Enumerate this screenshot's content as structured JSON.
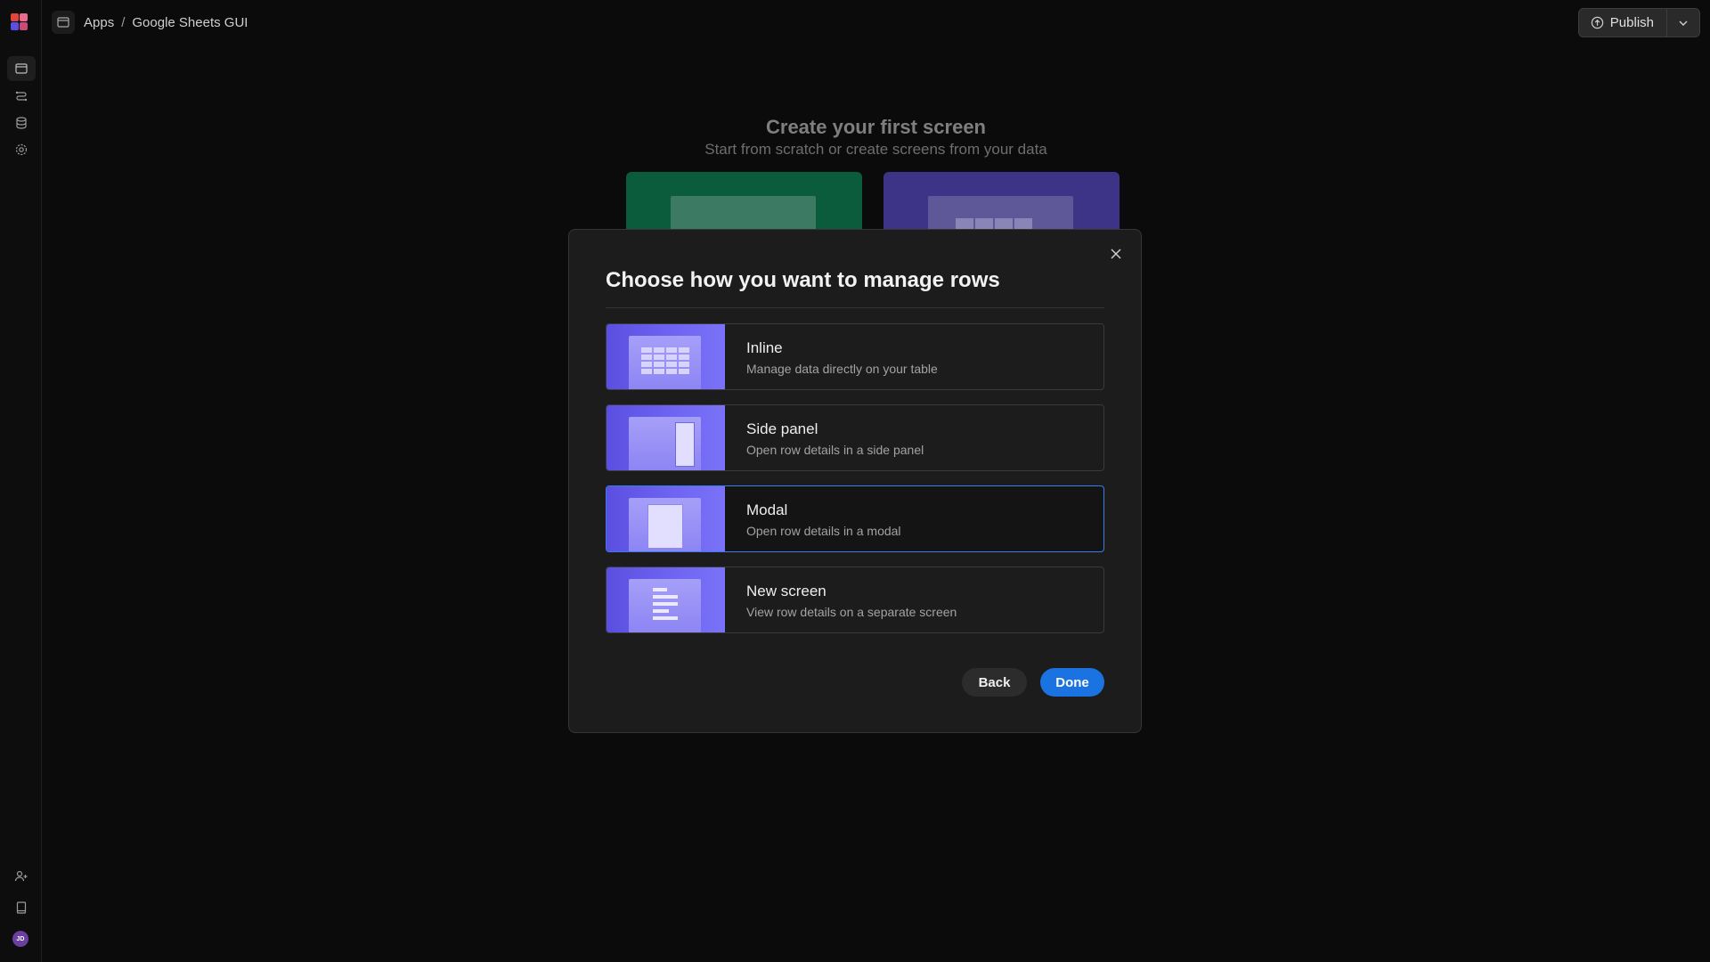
{
  "topbar": {
    "breadcrumb": [
      "Apps",
      "/",
      "Google Sheets GUI"
    ],
    "publish_label": "Publish"
  },
  "rail": {
    "items": [
      "screens-icon",
      "automations-icon",
      "data-icon",
      "settings-icon"
    ],
    "bottom": [
      "invite-user-icon",
      "docs-icon"
    ],
    "avatar_initials": "JD"
  },
  "background": {
    "title": "Create your first screen",
    "subtitle": "Start from scratch or create screens from your data"
  },
  "modal": {
    "title": "Choose how you want to manage rows",
    "options": [
      {
        "label": "Inline",
        "desc": "Manage data directly on your table"
      },
      {
        "label": "Side panel",
        "desc": "Open row details in a side panel"
      },
      {
        "label": "Modal",
        "desc": "Open row details in a modal"
      },
      {
        "label": "New screen",
        "desc": "View row details on a separate screen"
      }
    ],
    "selected": "Modal",
    "back_label": "Back",
    "done_label": "Done"
  },
  "colors": {
    "accent": "#1a73e0",
    "selected_border": "#3b7de8",
    "thumb": "#6e64f2"
  }
}
